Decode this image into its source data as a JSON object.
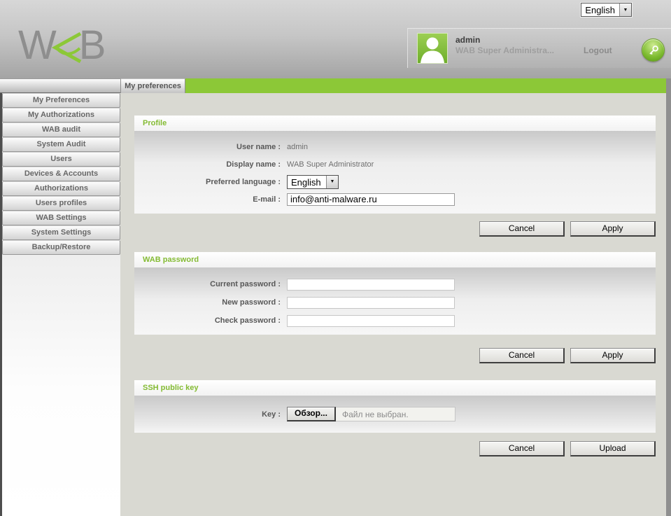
{
  "colors": {
    "accent_green": "#8cc837",
    "title_green": "#84bb33",
    "edge_gray": "#8f8f8f"
  },
  "icons": {
    "dropdown_arrow": "▼"
  },
  "top": {
    "language_select_value": "English"
  },
  "header": {
    "logo_left": "W",
    "logo_right": "B",
    "user": {
      "name": "admin",
      "role": "WAB Super Administra...",
      "logout_label": "Logout"
    }
  },
  "tabbar": {
    "active_tab": "My preferences"
  },
  "sidebar": {
    "items": [
      "My Preferences",
      "My Authorizations",
      "WAB audit",
      "System Audit",
      "Users",
      "Devices & Accounts",
      "Authorizations",
      "Users profiles",
      "WAB Settings",
      "System Settings",
      "Backup/Restore"
    ]
  },
  "profile": {
    "title": "Profile",
    "user_name_label": "User name :",
    "user_name_value": "admin",
    "display_name_label": "Display name :",
    "display_name_value": "WAB Super Administrator",
    "language_label": "Preferred language :",
    "language_value": "English",
    "email_label": "E-mail :",
    "email_value": "info@anti-malware.ru",
    "cancel_label": "Cancel",
    "apply_label": "Apply"
  },
  "wab_password": {
    "title": "WAB password",
    "current_label": "Current password :",
    "current_value": "",
    "new_label": "New password :",
    "new_value": "",
    "check_label": "Check password :",
    "check_value": "",
    "cancel_label": "Cancel",
    "apply_label": "Apply"
  },
  "ssh_key": {
    "title": "SSH public key",
    "key_label": "Key :",
    "browse_label": "Обзор...",
    "no_file_text": "Файл не выбран.",
    "cancel_label": "Cancel",
    "upload_label": "Upload"
  }
}
